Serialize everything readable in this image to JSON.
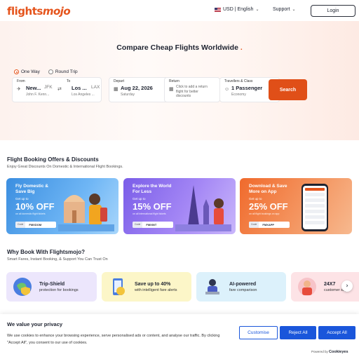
{
  "header": {
    "logo_main": "flights",
    "logo_accent": "mojo",
    "currency_label": "USD | English",
    "support_label": "Support",
    "login_label": "Login"
  },
  "hero": {
    "title": "Compare Cheap Flights Worldwide",
    "title_dot": ".",
    "trip_types": [
      "One Way",
      "Round Trip"
    ],
    "selected_trip": "One Way",
    "from": {
      "label": "From",
      "city": "New...",
      "code": "JFK",
      "airport": "John F. Kenn..."
    },
    "to": {
      "label": "To",
      "city": "Los ...",
      "code": "LAX",
      "airport": "Los Angeles ..."
    },
    "depart": {
      "label": "Depart",
      "date": "Aug 22, 2026",
      "day": "Saturday"
    },
    "return": {
      "label": "Return",
      "hint": "Click to add a return flight for better discounts"
    },
    "travellers": {
      "label": "Travellers & Class",
      "value": "1 Passenger",
      "cabin": "Economy"
    },
    "search_label": "Search"
  },
  "offers": {
    "title": "Flight Booking Offers & Discounts",
    "subtitle": "Enjoy Great Discounts On Domestic & International Flight Bookings.",
    "items": [
      {
        "title": "Fly Domestic & Save Big",
        "upto": "Get up to",
        "pct": "10% OFF",
        "fine": "on all domestic flight tickets",
        "code_label": "Code",
        "code": "FMXDOM"
      },
      {
        "title": "Explore the World For Less",
        "upto": "Get up to",
        "pct": "15% OFF",
        "fine": "on all international flight tickets",
        "code_label": "Code",
        "code": "FMXINT"
      },
      {
        "title": "Download & Save More on App",
        "upto": "Get up to",
        "pct": "25% OFF",
        "fine": "on all flight bookings on app",
        "code_label": "Code",
        "code": "FMXAPP"
      }
    ]
  },
  "why": {
    "title": "Why Book With Flightsmojo?",
    "subtitle": "Smart Fares, Instant Booking, & Support You Can Trust On",
    "features": [
      {
        "title": "Trip-Shield",
        "sub": "protection for bookings"
      },
      {
        "title": "Save up to 40%",
        "sub": "with intelligent fare alerts"
      },
      {
        "title": "AI-powered",
        "sub": "fare comparison"
      },
      {
        "title": "24X7",
        "sub": "customer sup"
      }
    ],
    "next_label": "›"
  },
  "cookie": {
    "title": "We value your privacy",
    "text": "We use cookies to enhance your browsing experience, serve personalised ads or content, and analyse our traffic. By clicking \"Accept All\", you consent to our use of cookies.",
    "customise": "Customise",
    "reject": "Reject All",
    "accept": "Accept All",
    "powered_by": "Powered by",
    "powered_brand": "Cookieyes"
  },
  "colors": {
    "brand": "#e5541c",
    "accent_blue": "#1a56db"
  }
}
